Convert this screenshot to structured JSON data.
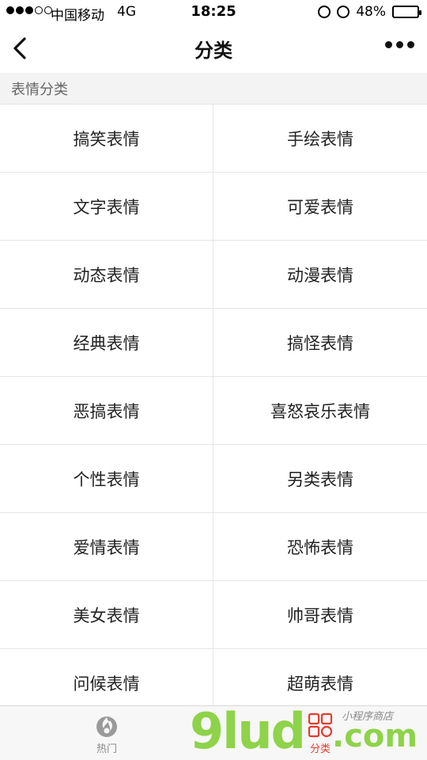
{
  "status_bar": {
    "carrier": "中国移动",
    "network": "4G",
    "time": "18:25",
    "battery_percent": "48%",
    "battery_level": 0.48,
    "signal_bars_filled": 3,
    "signal_bars_total": 5
  },
  "nav": {
    "title": "分类",
    "back_icon": "chevron-left-icon",
    "more_icon": "more-horizontal-icon"
  },
  "section": {
    "title": "表情分类"
  },
  "categories": [
    [
      "搞笑表情",
      "手绘表情"
    ],
    [
      "文字表情",
      "可爱表情"
    ],
    [
      "动态表情",
      "动漫表情"
    ],
    [
      "经典表情",
      "搞怪表情"
    ],
    [
      "恶搞表情",
      "喜怒哀乐表情"
    ],
    [
      "个性表情",
      "另类表情"
    ],
    [
      "爱情表情",
      "恐怖表情"
    ],
    [
      "美女表情",
      "帅哥表情"
    ],
    [
      "问候表情",
      "超萌表情"
    ]
  ],
  "tab_bar": {
    "tabs": [
      {
        "label": "热门",
        "icon": "flame-icon",
        "active": false
      },
      {
        "label": "分类",
        "icon": "grid-icon",
        "active": true
      }
    ]
  },
  "watermark": {
    "brand": "9lud",
    "suffix": ".com",
    "tagline": "小程序商店"
  },
  "colors": {
    "accent": "#e63b2e",
    "watermark_green": "#8ed34a",
    "section_bg": "#f3f3f3",
    "divider": "#e5e5e5"
  }
}
